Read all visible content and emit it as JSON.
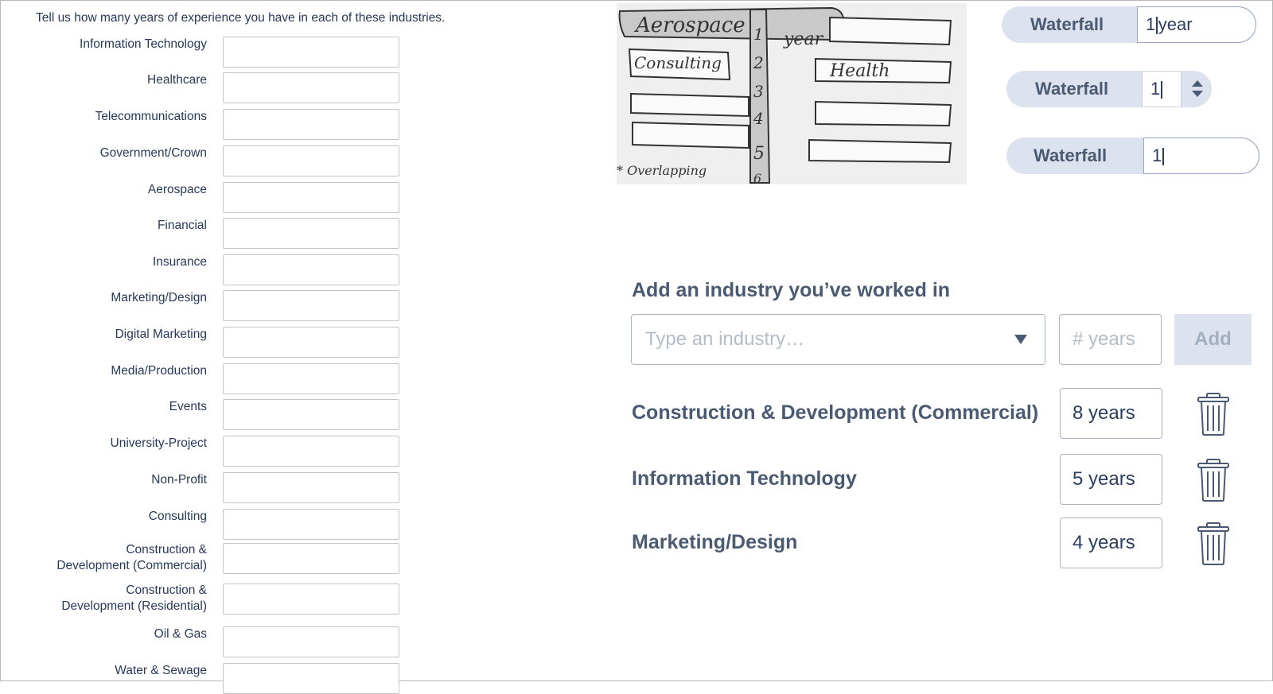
{
  "form": {
    "intro": "Tell us how many years of experience you have in each of these industries.",
    "industries": [
      "Information Technology",
      "Healthcare",
      "Telecommunications",
      "Government/Crown",
      "Aerospace",
      "Financial",
      "Insurance",
      "Marketing/Design",
      "Digital Marketing",
      "Media/Production",
      "Events",
      "University-Project",
      "Non-Profit",
      "Consulting",
      "Construction &\nDevelopment (Commercial)",
      "Construction &\nDevelopment (Residential)",
      "Oil & Gas",
      "Water & Sewage"
    ]
  },
  "sketch": {
    "words": [
      "Aerospace",
      "year",
      "Consulting",
      "Health",
      "1",
      "2",
      "3",
      "4",
      "5",
      "6",
      "* Overlapping"
    ]
  },
  "waterfall": {
    "label": "Waterfall",
    "w1_value": "1",
    "w1_suffix": "year",
    "w2_value": "1",
    "w3_value": "1"
  },
  "add_panel": {
    "title": "Add an industry you’ve worked in",
    "industry_placeholder": "Type an industry…",
    "years_placeholder": "# years",
    "add_label": "Add",
    "entries": [
      {
        "name": "Construction & Development (Commercial)",
        "years": "8 years"
      },
      {
        "name": "Information Technology",
        "years": "5 years"
      },
      {
        "name": "Marketing/Design",
        "years": "4 years"
      }
    ]
  },
  "colors": {
    "text_dark": "#27395b",
    "label_muted": "#4a5a72",
    "pill_bg": "#dde3ee",
    "placeholder": "#b3bcc9"
  }
}
